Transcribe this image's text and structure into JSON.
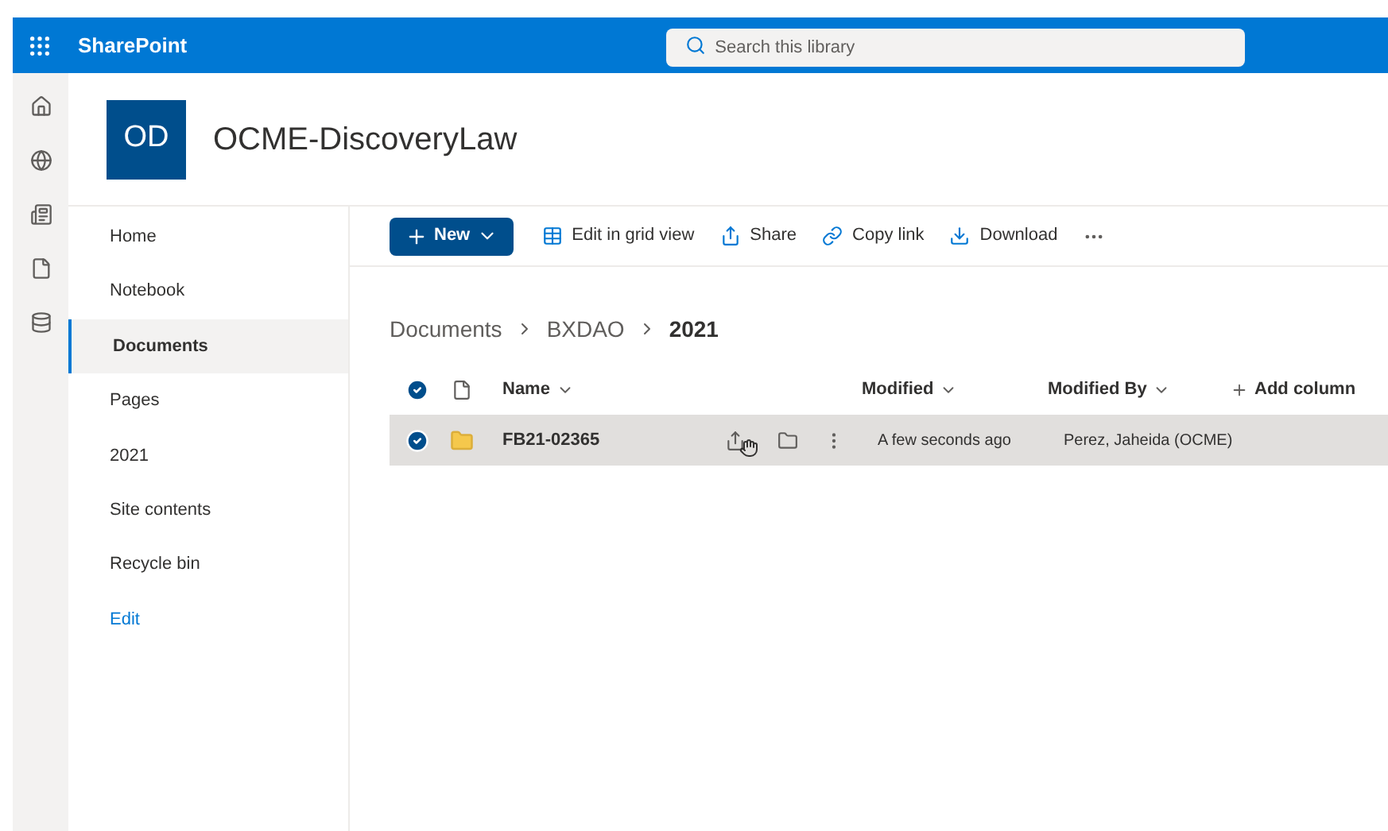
{
  "app_bar": {
    "title": "SharePoint",
    "search": {
      "placeholder": "Search this library"
    }
  },
  "site": {
    "initials": "OD",
    "title": "OCME-DiscoveryLaw"
  },
  "nav": [
    {
      "label": "Home",
      "selected": false,
      "kind": "item"
    },
    {
      "label": "Notebook",
      "selected": false,
      "kind": "item"
    },
    {
      "label": "Documents",
      "selected": true,
      "kind": "item"
    },
    {
      "label": "Pages",
      "selected": false,
      "kind": "item"
    },
    {
      "label": "2021",
      "selected": false,
      "kind": "item"
    },
    {
      "label": "Site contents",
      "selected": false,
      "kind": "item"
    },
    {
      "label": "Recycle bin",
      "selected": false,
      "kind": "item"
    },
    {
      "label": "Edit",
      "selected": false,
      "kind": "link"
    }
  ],
  "commands": [
    {
      "label": "New",
      "kind": "primary"
    },
    {
      "label": "Edit in grid view",
      "kind": "grid"
    },
    {
      "label": "Share",
      "kind": "share"
    },
    {
      "label": "Copy link",
      "kind": "link"
    },
    {
      "label": "Download",
      "kind": "download"
    }
  ],
  "breadcrumb": [
    {
      "label": "Documents",
      "current": false
    },
    {
      "label": "BXDAO",
      "current": false
    },
    {
      "label": "2021",
      "current": true
    }
  ],
  "table": {
    "all_selected": true,
    "columns": [
      "Name",
      "Modified",
      "Modified By",
      "Add column"
    ],
    "rows": [
      {
        "name": "FB21-02365",
        "modified": "A few seconds ago",
        "modified_by": "Perez, Jaheida (OCME)",
        "selected": true
      }
    ]
  }
}
